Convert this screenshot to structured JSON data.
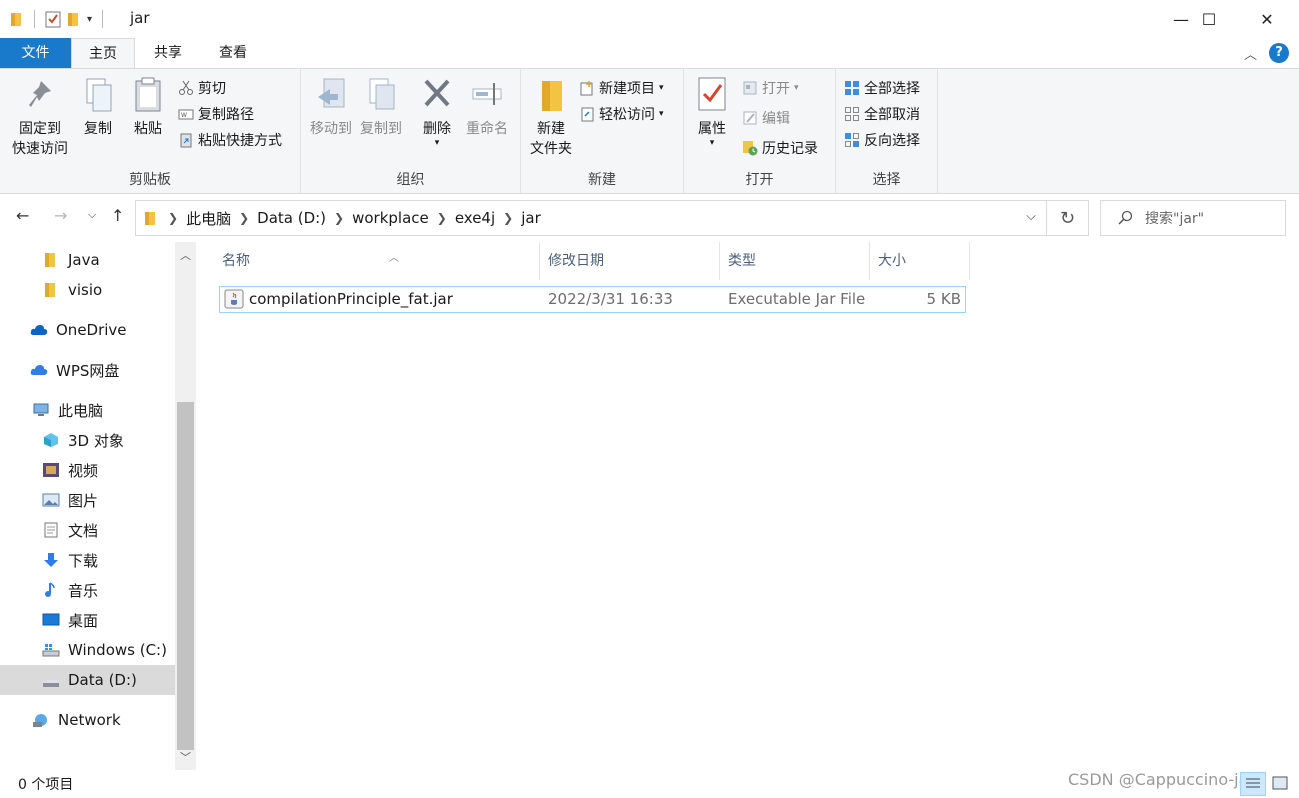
{
  "window": {
    "title": "jar",
    "minimize_glyph": "—",
    "maximize_glyph": "☐",
    "close_glyph": "✕"
  },
  "tabs": {
    "file": "文件",
    "home": "主页",
    "share": "共享",
    "view": "查看"
  },
  "ribbon": {
    "clipboard": {
      "label": "剪贴板",
      "pin_line1": "固定到",
      "pin_line2": "快速访问",
      "copy": "复制",
      "paste": "粘贴",
      "cut": "剪切",
      "copy_path": "复制路径",
      "paste_shortcut": "粘贴快捷方式"
    },
    "organize": {
      "label": "组织",
      "move_to": "移动到",
      "copy_to": "复制到",
      "delete": "删除",
      "rename": "重命名"
    },
    "new": {
      "label": "新建",
      "new_folder_line1": "新建",
      "new_folder_line2": "文件夹",
      "new_item": "新建项目",
      "easy_access": "轻松访问"
    },
    "open": {
      "label": "打开",
      "properties": "属性",
      "open": "打开",
      "edit": "编辑",
      "history": "历史记录"
    },
    "select": {
      "label": "选择",
      "select_all": "全部选择",
      "select_none": "全部取消",
      "invert": "反向选择"
    }
  },
  "address": {
    "crumbs": [
      "此电脑",
      "Data (D:)",
      "workplace",
      "exe4j",
      "jar"
    ],
    "search_placeholder": "搜索\"jar\""
  },
  "nav": {
    "items": [
      {
        "label": "Java",
        "icon": "folder-icon"
      },
      {
        "label": "visio",
        "icon": "folder-icon"
      },
      {
        "label": "OneDrive",
        "icon": "cloud-icon"
      },
      {
        "label": "WPS网盘",
        "icon": "cloud-icon"
      },
      {
        "label": "此电脑",
        "icon": "computer-icon"
      },
      {
        "label": "3D 对象",
        "icon": "cube-icon"
      },
      {
        "label": "视频",
        "icon": "video-icon"
      },
      {
        "label": "图片",
        "icon": "picture-icon"
      },
      {
        "label": "文档",
        "icon": "document-icon"
      },
      {
        "label": "下载",
        "icon": "download-icon"
      },
      {
        "label": "音乐",
        "icon": "music-icon"
      },
      {
        "label": "桌面",
        "icon": "desktop-icon"
      },
      {
        "label": "Windows (C:)",
        "icon": "drive-icon"
      },
      {
        "label": "Data (D:)",
        "icon": "drive-icon"
      },
      {
        "label": "Network",
        "icon": "network-icon"
      }
    ]
  },
  "columns": {
    "name": "名称",
    "modified": "修改日期",
    "type": "类型",
    "size": "大小"
  },
  "files": [
    {
      "name": "compilationPrinciple_fat.jar",
      "modified": "2022/3/31 16:33",
      "type": "Executable Jar File",
      "size": "5 KB"
    }
  ],
  "status": {
    "item_count": "0 个项目",
    "watermark": "CSDN @Cappuccino-jay"
  },
  "colors": {
    "accent": "#1979ca",
    "folder": "#f3c343",
    "selection_border": "#99d1ff"
  }
}
